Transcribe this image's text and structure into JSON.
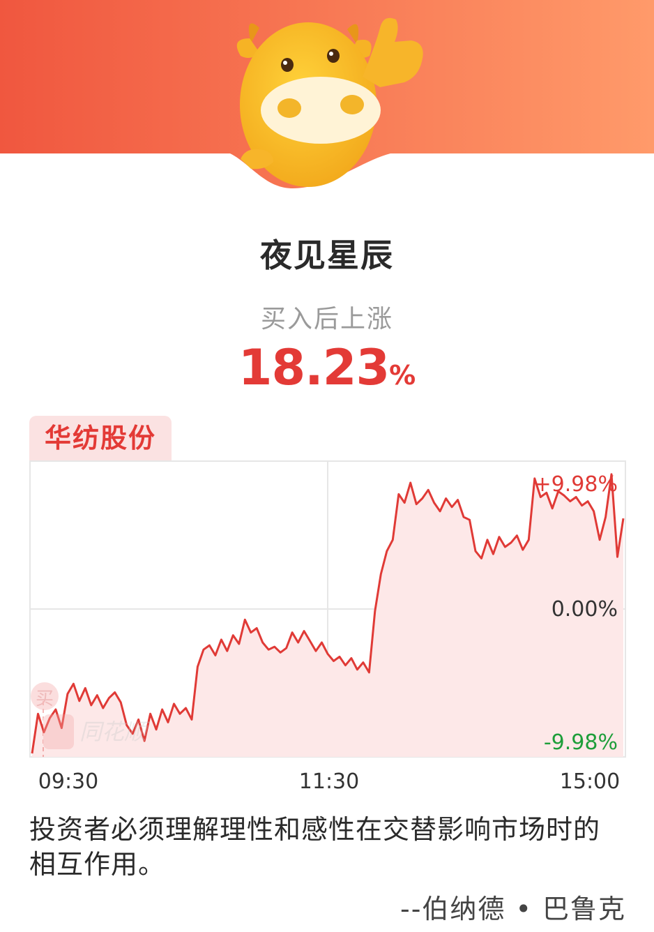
{
  "banner": {
    "colors": {
      "left": "#f0573f",
      "right": "#ff9a6a"
    },
    "mascot": "cartoon-cow-thumbs-up"
  },
  "pattern_name": "夜见星辰",
  "gain_label": "买入后上涨",
  "gain_value": "18.23",
  "gain_unit": "%",
  "stock_name": "华纺股份",
  "watermark": {
    "buy_marker": "买",
    "logo_text": "同花顺"
  },
  "quote": {
    "text": "投资者必须理解理性和感性在交替影响市场时的相互作用。",
    "author": "--伯纳德 • 巴鲁克"
  },
  "chart_data": {
    "type": "line",
    "x_ticks": [
      "09:30",
      "11:30",
      "15:00"
    ],
    "y_tick_labels": [
      "+9.98%",
      "0.00%",
      "-9.98%"
    ],
    "ylim": [
      -9.98,
      9.98
    ],
    "colors": {
      "line": "#e03a36",
      "fill": "#fde8e8",
      "up": "#e03a36",
      "down": "#1e9e3a",
      "zero": "#333333"
    },
    "series": [
      {
        "values": [
          -9.98,
          -7.2,
          -8.5,
          -7.5,
          -6.9,
          -8.2,
          -5.8,
          -5.1,
          -6.3,
          -5.4,
          -6.6,
          -5.9,
          -6.8,
          -6.1,
          -5.7,
          -6.4,
          -8.0,
          -8.6,
          -7.6,
          -9.1,
          -7.2,
          -8.3,
          -6.9,
          -7.8,
          -6.5,
          -7.2,
          -6.8,
          -7.6,
          -3.9,
          -2.7,
          -2.4,
          -3.1,
          -2.0,
          -2.8,
          -1.7,
          -2.3,
          -0.6,
          -1.5,
          -1.2,
          -2.2,
          -2.7,
          -2.5,
          -2.9,
          -2.6,
          -1.5,
          -2.2,
          -1.4,
          -2.1,
          -2.8,
          -2.2,
          -3.0,
          -3.5,
          -3.2,
          -3.8,
          -3.3,
          -4.1,
          -3.6,
          -4.3,
          0.0,
          2.6,
          4.2,
          5.0,
          8.2,
          7.6,
          9.0,
          7.5,
          7.9,
          8.5,
          7.6,
          7.0,
          7.9,
          7.3,
          7.8,
          6.6,
          6.4,
          4.2,
          3.7,
          5.0,
          4.0,
          5.2,
          4.5,
          4.8,
          5.3,
          4.3,
          5.0,
          9.3,
          8.0,
          8.3,
          7.2,
          8.4,
          8.1,
          7.7,
          8.0,
          7.4,
          7.7,
          7.0,
          5.0,
          6.6,
          9.6,
          3.8,
          6.5
        ]
      }
    ]
  }
}
